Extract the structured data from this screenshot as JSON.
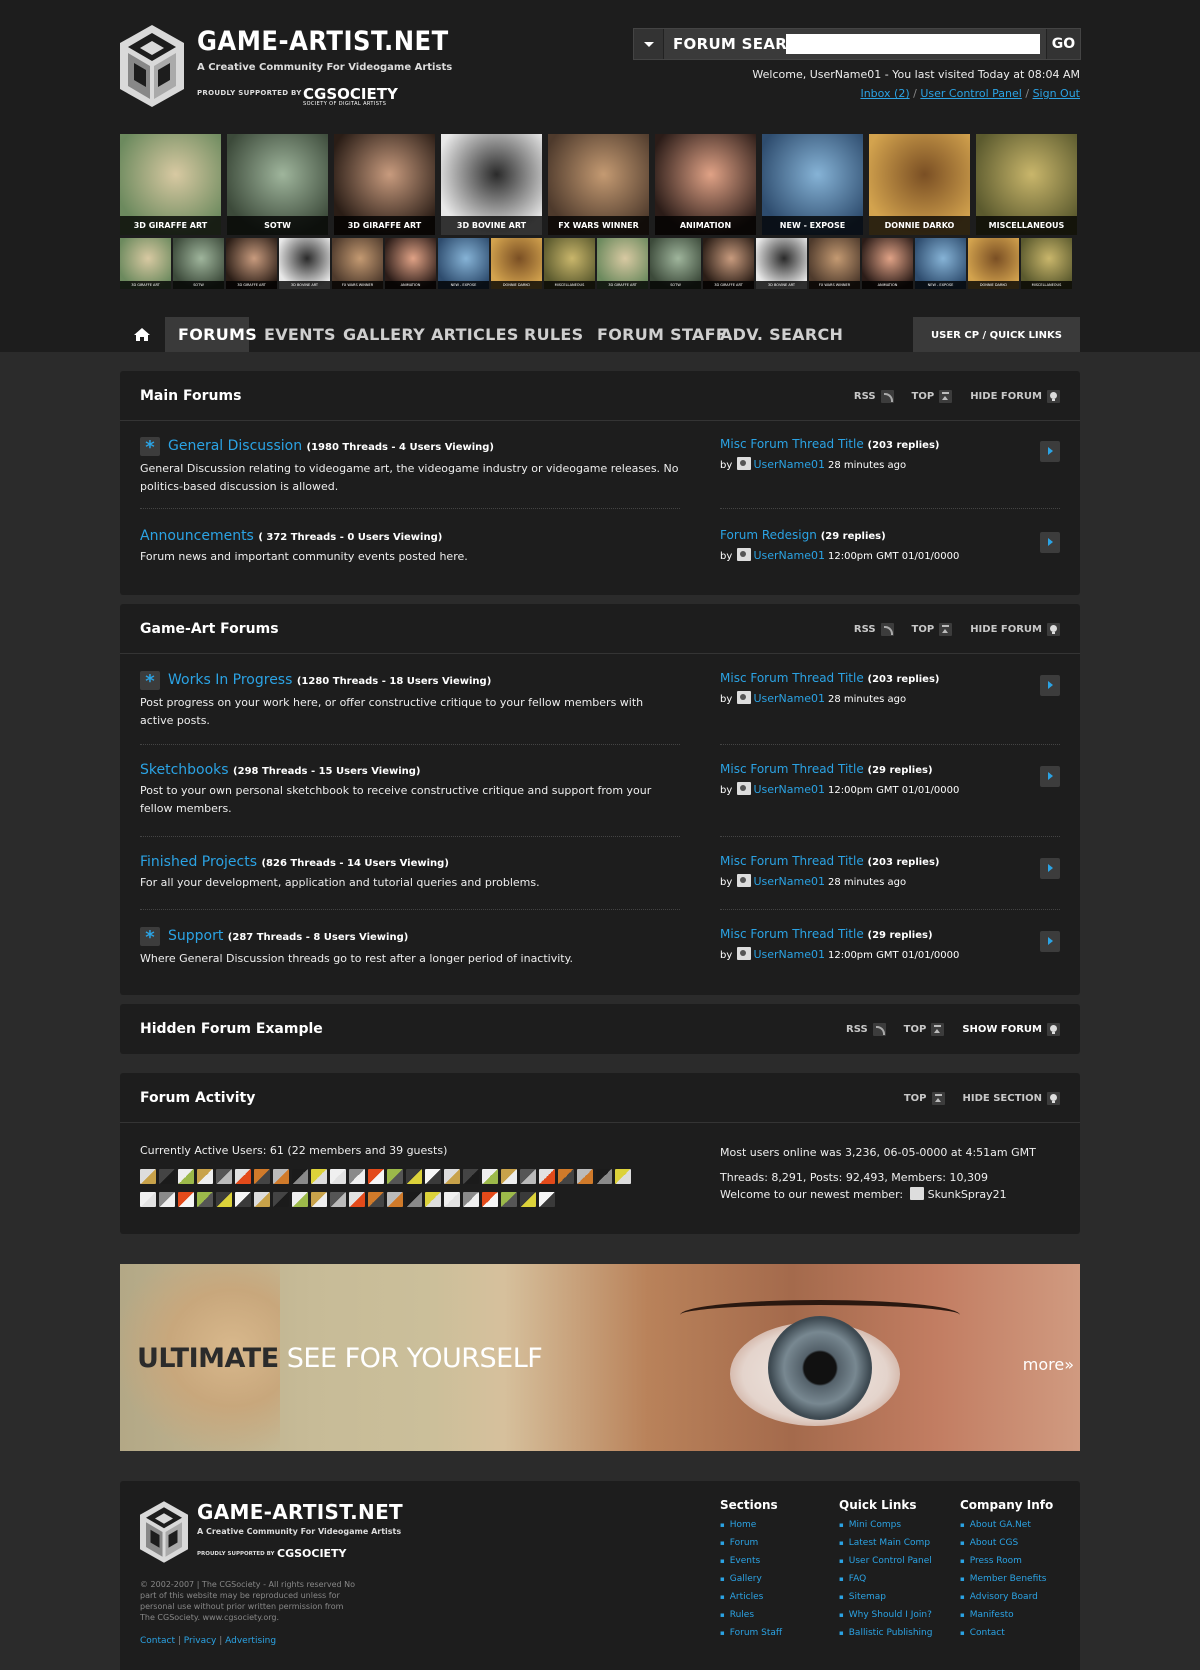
{
  "site": {
    "title": "GAME-ARTIST.NET",
    "tagline": "A Creative Community For Videogame Artists",
    "supported_by": "PROUDLY SUPPORTED BY",
    "sponsor": "CGSOCIETY",
    "sponsor_sub": "SOCIETY OF DIGITAL ARTISTS"
  },
  "search": {
    "label": "FORUM SEARCH",
    "placeholder": "",
    "go": "GO"
  },
  "user": {
    "welcome": "Welcome, UserName01 - You last visited Today at 08:04 AM",
    "inbox": "Inbox (2)",
    "ucp": "User Control Panel",
    "signout": "Sign Out"
  },
  "thumbnails": {
    "big": [
      "3D GIRAFFE ART",
      "SOTW",
      "3D GIRAFFE ART",
      "3D BOVINE ART",
      "FX WARS WINNER",
      "ANIMATION",
      "NEW - EXPOSE",
      "DONNIE DARKO",
      "MISCELLANEOUS"
    ],
    "small": [
      "3D GIRAFFE ART",
      "SOTW",
      "3D GIRAFFE ART",
      "3D BOVINE ART",
      "FX WARS WINNER",
      "ANIMATION",
      "NEW - EXPOSE",
      "DONNIE DARKO",
      "MISCELLANEOUS",
      "3D GIRAFFE ART",
      "SOTW",
      "3D GIRAFFE ART",
      "3D BOVINE ART",
      "FX WARS WINNER",
      "ANIMATION",
      "NEW - EXPOSE",
      "DONNIE DARKO",
      "MISCELLANEOUS"
    ]
  },
  "nav": {
    "items": [
      "FORUMS",
      "EVENTS",
      "GALLERY",
      "ARTICLES",
      "RULES",
      "FORUM STAFF",
      "ADV. SEARCH"
    ],
    "user_cp": "USER CP / QUICK LINKS"
  },
  "controls": {
    "rss": "RSS",
    "top": "TOP",
    "hide_forum": "HIDE FORUM",
    "show_forum": "SHOW FORUM",
    "hide_section": "HIDE SECTION"
  },
  "main_forums": {
    "title": "Main Forums",
    "forums": [
      {
        "name": "General Discussion",
        "meta": "(1980 Threads - 4 Users Viewing)",
        "desc": "General Discussion relating to videogame art, the videogame industry or videogame releases. No politics-based discussion is allowed.",
        "last_title": "Misc Forum Thread Title",
        "last_meta": "(203 replies)",
        "last_user": "UserName01",
        "last_time": "28 minutes ago"
      },
      {
        "name": "Announcements",
        "meta": "( 372 Threads - 0 Users Viewing)",
        "desc": "Forum news and important community events posted here.",
        "last_title": "Forum Redesign",
        "last_meta": "(29 replies)",
        "last_user": "UserName01",
        "last_time": "12:00pm GMT 01/01/0000"
      }
    ]
  },
  "gameart_forums": {
    "title": "Game-Art Forums",
    "forums": [
      {
        "name": "Works In Progress",
        "meta": "(1280 Threads - 18 Users Viewing)",
        "desc": "Post progress on your work here, or offer constructive critique to your fellow members with active posts.",
        "last_title": "Misc Forum Thread Title",
        "last_meta": "(203 replies)",
        "last_user": "UserName01",
        "last_time": "28 minutes ago"
      },
      {
        "name": "Sketchbooks",
        "meta": "(298 Threads - 15 Users Viewing)",
        "desc": "Post to your own personal sketchbook to receive constructive critique and support from your fellow members.",
        "last_title": "Misc Forum Thread Title",
        "last_meta": "(29 replies)",
        "last_user": "UserName01",
        "last_time": "12:00pm GMT 01/01/0000"
      },
      {
        "name": "Finished Projects",
        "meta": "(826 Threads - 14 Users Viewing)",
        "desc": "For all your development, application and tutorial queries and problems.",
        "last_title": "Misc Forum Thread Title",
        "last_meta": "(203 replies)",
        "last_user": "UserName01",
        "last_time": "28 minutes ago"
      },
      {
        "name": "Support",
        "meta": "(287 Threads - 8 Users Viewing)",
        "desc": "Where General Discussion threads go to rest after a longer period of inactivity.",
        "last_title": "Misc Forum Thread Title",
        "last_meta": "(29 replies)",
        "last_user": "UserName01",
        "last_time": "12:00pm GMT 01/01/0000"
      }
    ]
  },
  "hidden_forum": {
    "title": "Hidden Forum Example"
  },
  "activity": {
    "title": "Forum Activity",
    "active_users": "Currently Active Users: 61 (22 members and 39 guests)",
    "most_online": "Most users online was 3,236, 06-05-0000 at 4:51am GMT",
    "stats": "Threads: 8,291, Posts: 92,493, Members: 10,309",
    "newest_label": "Welcome to our newest member:",
    "newest_member": "SkunkSpray21"
  },
  "banner": {
    "text_bold": "ULTIMATE",
    "text_light": "SEE FOR YOURSELF",
    "more": "more»"
  },
  "footer": {
    "copyright": "© 2002-2007 | The CGSociety - All rights reserved No part of this website may be reproduced unless for personal use without prior written permission from The CGSociety. www.cgsociety.org.",
    "links": [
      "Contact",
      "Privacy",
      "Advertising"
    ],
    "columns": [
      {
        "title": "Sections",
        "items": [
          "Home",
          "Forum",
          "Events",
          "Gallery",
          "Articles",
          "Rules",
          "Forum Staff"
        ]
      },
      {
        "title": "Quick Links",
        "items": [
          "Mini Comps",
          "Latest Main Comp",
          "User Control Panel",
          "FAQ",
          "Sitemap",
          "Why Should I Join?",
          "Ballistic Publishing"
        ]
      },
      {
        "title": "Company Info",
        "items": [
          "About GA.Net",
          "About CGS",
          "Press Room",
          "Member Benefits",
          "Advisory Board",
          "Manifesto",
          "Contact"
        ]
      }
    ]
  }
}
